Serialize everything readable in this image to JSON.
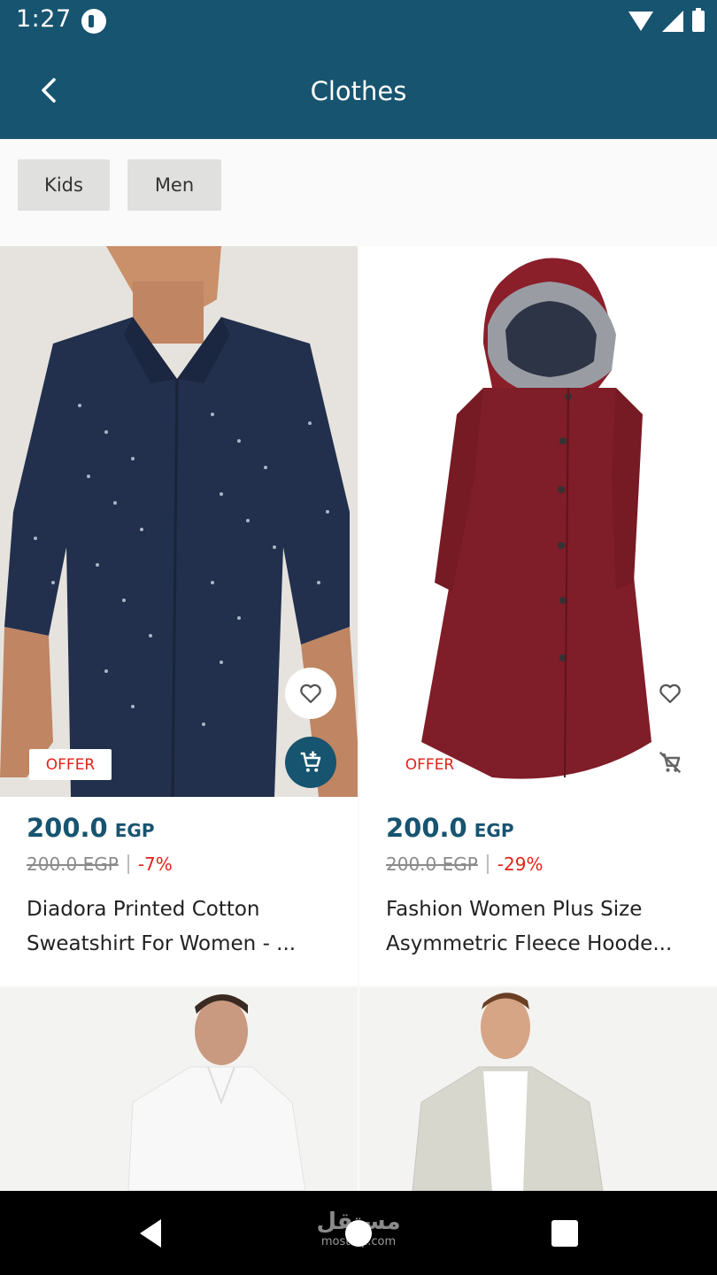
{
  "status_bar": {
    "time": "1:27"
  },
  "app_bar": {
    "title": "Clothes"
  },
  "filters": {
    "chips": [
      "Kids",
      "Men"
    ]
  },
  "products": [
    {
      "offer_label": "OFFER",
      "price": "200.0",
      "currency": "EGP",
      "old_price": "200.0 EGP",
      "discount": "-7%",
      "name_line1": "Diadora Printed Cotton",
      "name_line2": "Sweatshirt For Women - ..."
    },
    {
      "offer_label": "OFFER",
      "price": "200.0",
      "currency": "EGP",
      "old_price": "200.0 EGP",
      "discount": "-29%",
      "name_line1": "Fashion Women Plus Size",
      "name_line2": "Asymmetric Fleece Hoode..."
    }
  ],
  "watermark": {
    "text_ar": "مستقل",
    "text_en": "mostaql.com"
  },
  "colors": {
    "primary": "#175470",
    "offer": "#e2231a",
    "chip_bg": "#e0e0df"
  },
  "icons": {
    "back": "chevron-left-icon",
    "favorite": "heart-outline-icon",
    "add_to_cart": "add-shopping-cart-icon",
    "remove_from_cart": "remove-shopping-cart-icon"
  }
}
